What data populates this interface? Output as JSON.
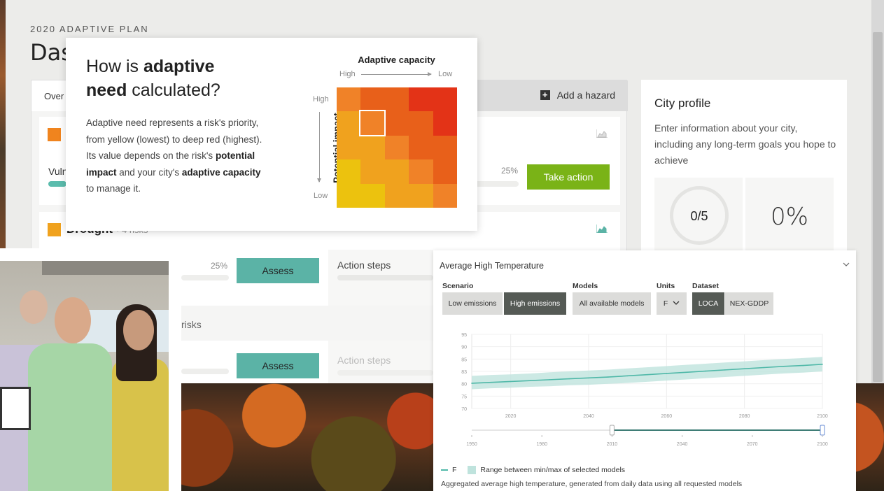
{
  "dashboard": {
    "eyebrow": "2020 ADAPTIVE PLAN",
    "title": "Das",
    "overview_tab": "Over",
    "add_hazard": "Add a hazard",
    "hazards": [
      {
        "color": "#f0841e",
        "name": "",
        "count": "",
        "vulnerability_label": "Vuln",
        "assess_percent": "25%",
        "action_label": "Take action"
      },
      {
        "color": "#f0a21e",
        "name": "Drought",
        "count": "• 4 risks",
        "assess_percent": "25%",
        "assess_label": "Assess",
        "action_steps": "Action steps"
      },
      {
        "name": "",
        "count": "risks",
        "assess_label": "Assess",
        "action_steps": "Action steps"
      }
    ]
  },
  "city_profile": {
    "title": "City profile",
    "description": "Enter information about your city, including any long-term goals you hope to achieve",
    "stat_progress": "0/5",
    "stat_percent": "0%"
  },
  "popup": {
    "question_pre": "How is ",
    "question_bold1": "adaptive",
    "question_bold2": "need",
    "question_post": " calculated?",
    "desc1": "Adaptive need represents a risk's priority, from yellow (lowest) to deep red (highest). Its value depends on the risk's ",
    "desc_bold1": "potential impact",
    "desc2": " and your city's ",
    "desc_bold2": "adaptive capacity",
    "desc3": " to manage it.",
    "matrix": {
      "title": "Adaptive capacity",
      "x_high": "High",
      "x_low": "Low",
      "y_label": "Potential impact",
      "y_high": "High",
      "y_low": "Low",
      "cells": [
        [
          "#f08228",
          "#e8601a",
          "#e8601a",
          "#e33317",
          "#e33317"
        ],
        [
          "#f0a21e",
          "#f08228",
          "#e8601a",
          "#e8601a",
          "#e33317"
        ],
        [
          "#f0a21e",
          "#f0a21e",
          "#f08228",
          "#e8601a",
          "#e8601a"
        ],
        [
          "#ecc20e",
          "#f0a21e",
          "#f0a21e",
          "#f08228",
          "#e8601a"
        ],
        [
          "#ecc20e",
          "#ecc20e",
          "#f0a21e",
          "#f0a21e",
          "#f08228"
        ]
      ],
      "selected": {
        "row": 1,
        "col": 1
      }
    }
  },
  "temperature": {
    "title": "Average High Temperature",
    "scenario_label": "Scenario",
    "scenario_options": [
      "Low emissions",
      "High emissions"
    ],
    "scenario_selected": "High emissions",
    "models_label": "Models",
    "models_value": "All available models",
    "units_label": "Units",
    "units_value": "F",
    "dataset_label": "Dataset",
    "dataset_options": [
      "LOCA",
      "NEX-GDDP"
    ],
    "dataset_selected": "LOCA",
    "legend_series": "F",
    "legend_range": "Range between min/max of selected models",
    "caption": "Aggregated average high temperature, generated from daily data using all requested models"
  },
  "chart_data": {
    "type": "area",
    "title": "Average High Temperature",
    "x": [
      2010,
      2015,
      2020,
      2025,
      2030,
      2035,
      2040,
      2045,
      2050,
      2055,
      2060,
      2065,
      2070,
      2075,
      2080,
      2085,
      2090,
      2095,
      2100
    ],
    "series": [
      {
        "name": "F",
        "values": [
          78.5,
          78.8,
          79.1,
          79.4,
          79.7,
          80.0,
          80.3,
          80.6,
          81.0,
          81.4,
          81.8,
          82.2,
          82.6,
          83.0,
          83.4,
          83.8,
          84.2,
          84.5,
          84.9
        ]
      },
      {
        "name": "Range between min/max of selected models",
        "min": [
          76.5,
          76.8,
          77.0,
          77.3,
          77.5,
          77.8,
          78.0,
          78.3,
          78.6,
          79.0,
          79.4,
          79.8,
          80.2,
          80.6,
          81.0,
          81.4,
          81.8,
          82.1,
          82.5
        ],
        "max": [
          81.0,
          81.3,
          81.5,
          81.8,
          82.2,
          82.5,
          82.8,
          83.1,
          83.5,
          83.9,
          84.3,
          84.7,
          85.1,
          85.5,
          85.9,
          86.3,
          86.7,
          87.0,
          87.4
        ]
      }
    ],
    "yticks": [
      "70",
      "75",
      "80",
      "83",
      "85",
      "90",
      "95"
    ],
    "xticks_main": [
      "2020",
      "2040",
      "2060",
      "2080",
      "2100"
    ],
    "xticks_range": [
      "1950",
      "1980",
      "2010",
      "2040",
      "2070",
      "2100"
    ],
    "xlim": [
      2010,
      2100
    ],
    "ylim": [
      70,
      95
    ],
    "range_selection": [
      2010,
      2100
    ],
    "range_domain": [
      1950,
      2100
    ],
    "grid": true,
    "colors": {
      "line": "#4fb8a8",
      "band": "#bfe3dd"
    }
  }
}
